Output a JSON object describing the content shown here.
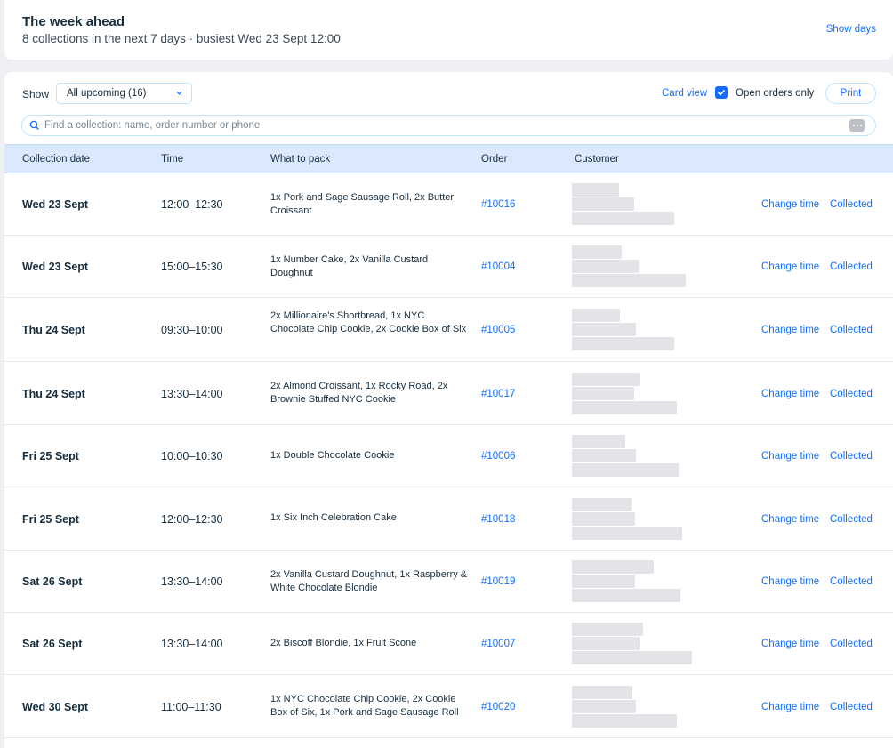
{
  "summary": {
    "title": "The week ahead",
    "subtitle": "8 collections in the next 7 days · busiest Wed 23 Sept 12:00",
    "show_days": "Show days"
  },
  "toolbar": {
    "show_label": "Show",
    "filter_value": "All upcoming (16)",
    "card_view": "Card view",
    "open_orders_checked": true,
    "open_orders_label": "Open orders only",
    "print": "Print"
  },
  "search": {
    "placeholder": "Find a collection: name, order number or phone"
  },
  "table": {
    "headers": {
      "date": "Collection date",
      "time": "Time",
      "pack": "What to pack",
      "order": "Order",
      "customer": "Customer"
    },
    "actions": {
      "change_time": "Change time",
      "collected": "Collected"
    },
    "rows": [
      {
        "date": "Wed 23 Sept",
        "time": "12:00–12:30",
        "pack": "1x Pork and Sage Sausage Roll, 2x Butter Croissant",
        "order": "#10016"
      },
      {
        "date": "Wed 23 Sept",
        "time": "15:00–15:30",
        "pack": "1x Number Cake, 2x Vanilla Custard Doughnut",
        "order": "#10004"
      },
      {
        "date": "Thu 24 Sept",
        "time": "09:30–10:00",
        "pack": "2x Millionaire's Shortbread, 1x NYC Chocolate Chip Cookie, 2x Cookie Box of Six",
        "order": "#10005"
      },
      {
        "date": "Thu 24 Sept",
        "time": "13:30–14:00",
        "pack": "2x Almond Croissant, 1x Rocky Road, 2x Brownie Stuffed NYC Cookie",
        "order": "#10017"
      },
      {
        "date": "Fri 25 Sept",
        "time": "10:00–10:30",
        "pack": "1x Double Chocolate Cookie",
        "order": "#10006"
      },
      {
        "date": "Fri 25 Sept",
        "time": "12:00–12:30",
        "pack": "1x Six Inch Celebration Cake",
        "order": "#10018"
      },
      {
        "date": "Sat 26 Sept",
        "time": "13:30–14:00",
        "pack": "2x Vanilla Custard Doughnut, 1x Raspberry & White Chocolate Blondie",
        "order": "#10019"
      },
      {
        "date": "Sat 26 Sept",
        "time": "13:30–14:00",
        "pack": "2x Biscoff Blondie, 1x Fruit Scone",
        "order": "#10007"
      },
      {
        "date": "Wed 30 Sept",
        "time": "11:00–11:30",
        "pack": "1x NYC Chocolate Chip Cookie, 2x Cookie Box of Six, 1x Pork and Sage Sausage Roll",
        "order": "#10020"
      }
    ]
  }
}
